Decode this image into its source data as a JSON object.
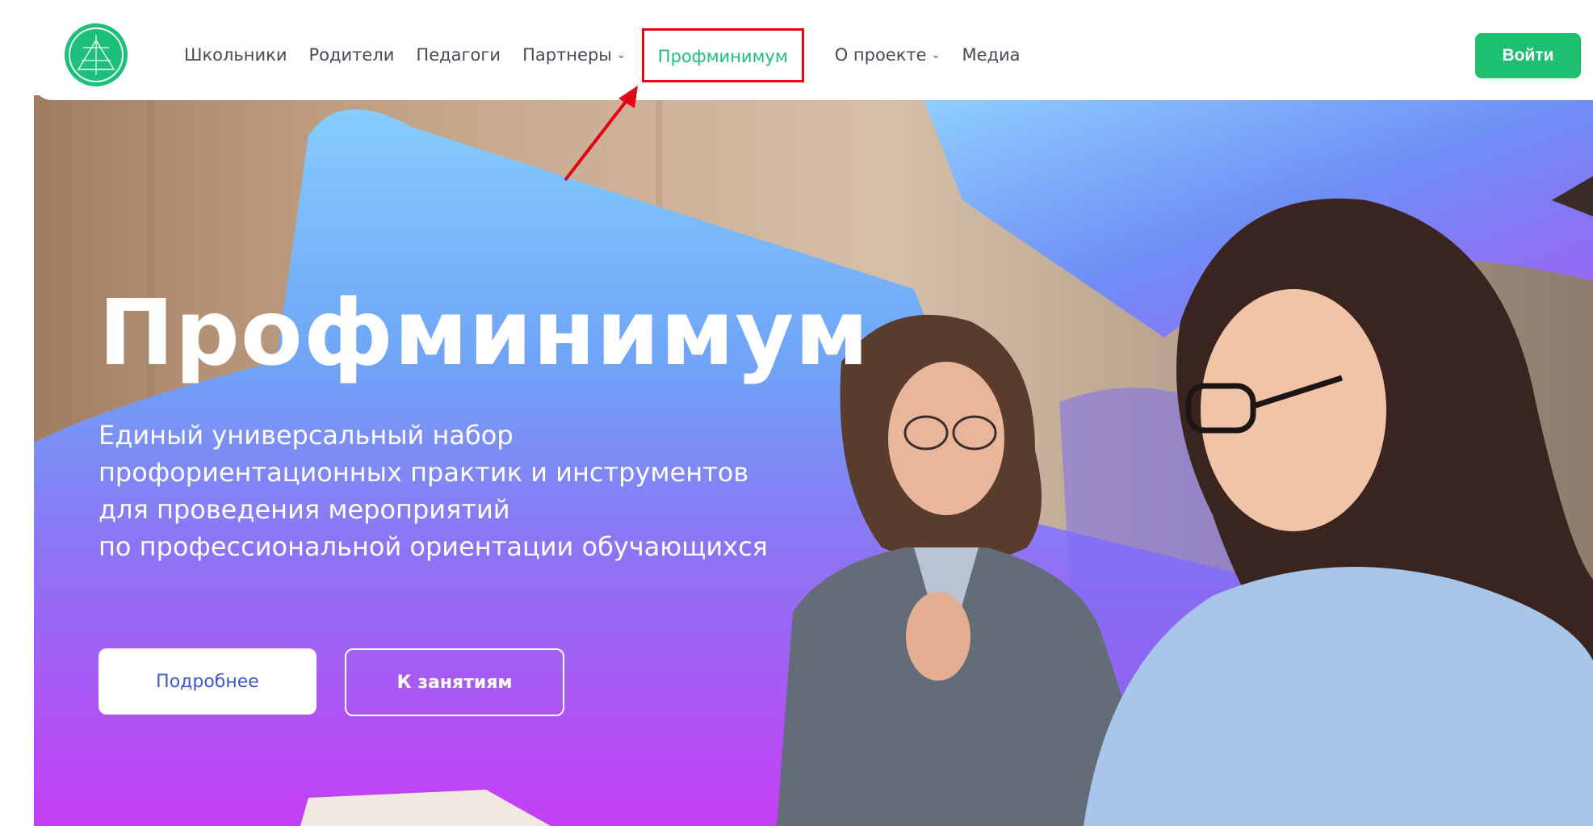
{
  "header": {
    "nav": [
      {
        "label": "Школьники",
        "has_dropdown": false
      },
      {
        "label": "Родители",
        "has_dropdown": false
      },
      {
        "label": "Педагоги",
        "has_dropdown": false
      },
      {
        "label": "Партнеры",
        "has_dropdown": true
      },
      {
        "label": "Профминимум",
        "has_dropdown": false,
        "active": true
      },
      {
        "label": "О проекте",
        "has_dropdown": true
      },
      {
        "label": "Медиа",
        "has_dropdown": false
      }
    ],
    "chevron_glyph": "⌄",
    "login_label": "Войти",
    "logo_icon": "brand-logo-icon"
  },
  "hero": {
    "title": "Профминимум",
    "subtitle_lines": [
      "Единый универсальный набор",
      "профориентационных практик и инструментов",
      "для проведения мероприятий",
      "по профессиональной ориентации обучающихся"
    ],
    "more_label": "Подробнее",
    "lessons_label": "К занятиям"
  },
  "colors": {
    "accent_green": "#1ebf6f",
    "highlight_red": "#e30613",
    "hero_blue": "#8fd0ff",
    "hero_violet": "#c53ef5"
  }
}
